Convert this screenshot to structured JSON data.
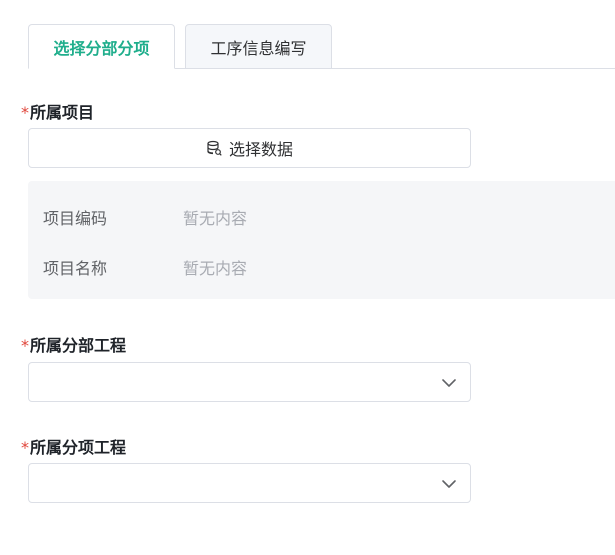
{
  "tabs": [
    {
      "label": "选择分部分项",
      "active": true
    },
    {
      "label": "工序信息编写",
      "active": false
    }
  ],
  "project": {
    "required_mark": "*",
    "label": "所属项目",
    "select_button_label": "选择数据",
    "select_button_icon": "database-icon",
    "info": [
      {
        "key": "项目编码",
        "value": "暂无内容"
      },
      {
        "key": "项目名称",
        "value": "暂无内容"
      }
    ]
  },
  "division": {
    "required_mark": "*",
    "label": "所属分部工程",
    "value": "",
    "icon": "chevron-down-icon"
  },
  "subitem": {
    "required_mark": "*",
    "label": "所属分项工程",
    "value": "",
    "icon": "chevron-down-icon"
  },
  "colors": {
    "accent": "#1fae8c",
    "required": "#e0453a",
    "panel_bg": "#f5f6f8",
    "border": "#dcdfe6",
    "placeholder": "#a8abb2"
  }
}
